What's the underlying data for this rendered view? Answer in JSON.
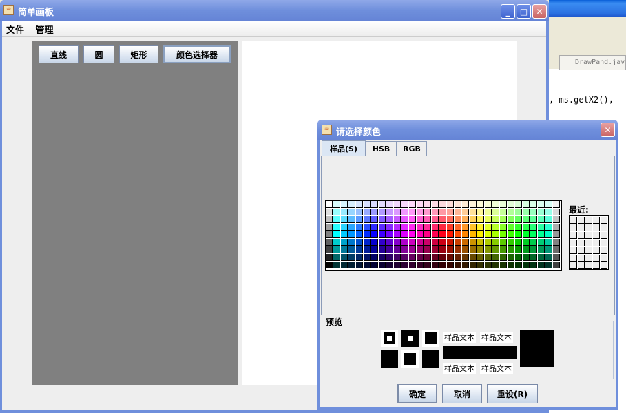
{
  "background_ide": {
    "tab_label": "DrawPand.jav",
    "code_line": ", ms.getX2(),"
  },
  "main_window": {
    "title": "简单画板",
    "menu": [
      "文件",
      "管理"
    ],
    "toolbar": [
      "直线",
      "圆",
      "矩形",
      "颜色选择器"
    ]
  },
  "color_dialog": {
    "title": "请选择颜色",
    "tabs": [
      "样品(S)",
      "HSB",
      "RGB"
    ],
    "recent_label": "最近:",
    "preview_label": "预览",
    "sample_text": "样品文本",
    "buttons": {
      "ok": "确定",
      "cancel": "取消",
      "reset": "重设(R)"
    }
  },
  "colors": {
    "title_bar": "#6f8fdc",
    "tool_panel": "#808080",
    "canvas": "#ffffff",
    "preview_color": "#000000"
  }
}
